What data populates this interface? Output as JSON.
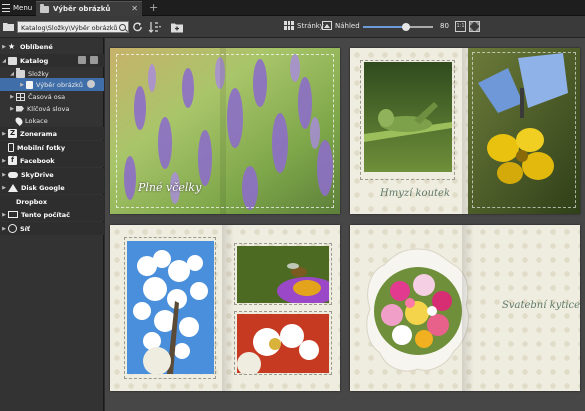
{
  "topbar": {
    "menu_label": "Menu",
    "tab_label": "Výběr obrázků",
    "tab_close": "✕",
    "tab_add": "+"
  },
  "toolbar": {
    "path": "Katalog\\Složky\\Výběr obrázků",
    "pages_label": "Stránky",
    "preview_label": "Náhled",
    "zoom_value": "80",
    "zoom_fraction": 0.62,
    "actual_size_label": "1:1"
  },
  "sidebar": {
    "favorites": "Oblíbené",
    "catalog": "Katalog",
    "folders": "Složky",
    "selected_folder": "Výběr obrázků",
    "timeline": "Časová osa",
    "keywords": "Klíčová slova",
    "locations": "Lokace",
    "zonerama": "Zonerama",
    "mobile_photos": "Mobilní fotky",
    "facebook": "Facebook",
    "skydrive": "SkyDrive",
    "google_drive": "Disk Google",
    "dropbox": "Dropbox",
    "this_pc": "Tento počítač",
    "network": "Síť"
  },
  "pages": {
    "lavender_caption": "Plné včelky",
    "insects_caption": "Hmyzí koutek",
    "bouquet_caption": "Svatební kytice"
  },
  "colors": {
    "selection": "#3f6ea8",
    "page_bg": "#efece0",
    "caption": "#5e7a6a"
  }
}
